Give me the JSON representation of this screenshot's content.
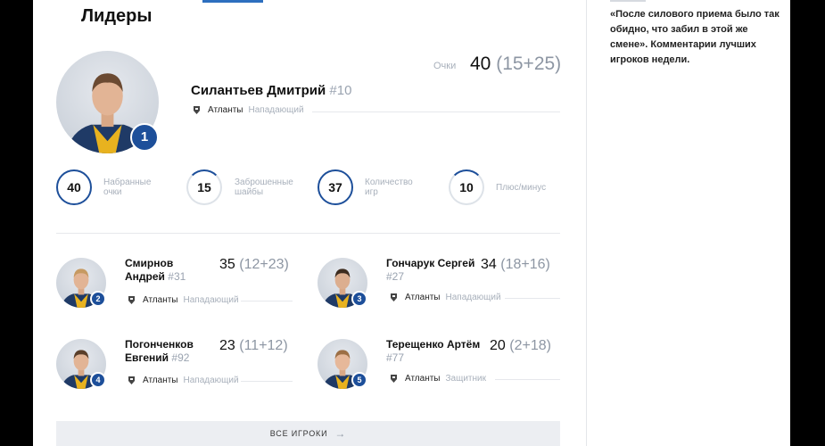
{
  "page": {
    "title": "Лидеры"
  },
  "leader": {
    "name": "Силантьев Дмитрий",
    "number": "#10",
    "team": "Атланты",
    "position": "Нападающий",
    "rank": "1",
    "points_label": "Очки",
    "points": "40",
    "points_breakdown": "(15+25)",
    "stats": [
      {
        "value": "40",
        "label": "Набранные очки"
      },
      {
        "value": "15",
        "label": "Заброшенные шайбы"
      },
      {
        "value": "37",
        "label": "Количество игр"
      },
      {
        "value": "10",
        "label": "Плюс/минус"
      }
    ]
  },
  "players": [
    {
      "rank": "2",
      "name_line1": "Смирнов",
      "name_line2": "Андрей",
      "number": "#31",
      "points": "35",
      "breakdown": "(12+23)",
      "team": "Атланты",
      "position": "Нападающий"
    },
    {
      "rank": "3",
      "name_line1": "Гончарук Сергей",
      "name_line2": "",
      "number": "#27",
      "points": "34",
      "breakdown": "(18+16)",
      "team": "Атланты",
      "position": "Нападающий"
    },
    {
      "rank": "4",
      "name_line1": "Погонченков",
      "name_line2": "Евгений",
      "number": "#92",
      "points": "23",
      "breakdown": "(11+12)",
      "team": "Атланты",
      "position": "Нападающий"
    },
    {
      "rank": "5",
      "name_line1": "Терещенко Артём",
      "name_line2": "",
      "number": "#77",
      "points": "20",
      "breakdown": "(2+18)",
      "team": "Атланты",
      "position": "Защитник"
    }
  ],
  "all_players_button": "ВСЕ ИГРОКИ",
  "all_players_arrow": "→",
  "news": {
    "text": "«После силового приема было так обидно, что забил в этой же смене». Комментарии лучших игроков недели."
  },
  "colors": {
    "accent": "#1d4f9a",
    "muted": "#a8b0bb",
    "jersey_gold": "#e8b21f",
    "jersey_navy": "#1f3a66"
  }
}
